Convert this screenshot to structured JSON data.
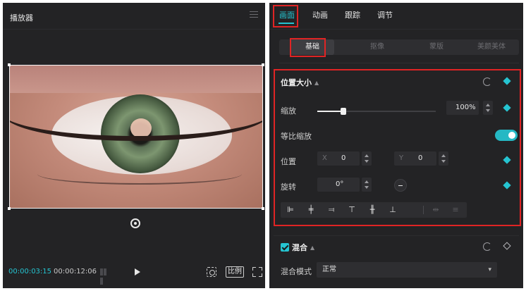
{
  "player": {
    "title": "播放器",
    "current_time": "00:00:03:15",
    "total_time": "00:00:12:06",
    "ratio_label": "比例"
  },
  "inspector": {
    "tabs": [
      {
        "label": "画面",
        "active": true
      },
      {
        "label": "动画",
        "active": false
      },
      {
        "label": "跟踪",
        "active": false
      },
      {
        "label": "调节",
        "active": false
      }
    ],
    "subtabs": [
      {
        "label": "基础",
        "active": true
      },
      {
        "label": "抠像",
        "active": false
      },
      {
        "label": "蒙版",
        "active": false
      },
      {
        "label": "美颜美体",
        "active": false
      }
    ],
    "position_size": {
      "title": "位置大小",
      "scale_label": "缩放",
      "scale_value": "100%",
      "scale_slider_level": 0.22,
      "uniform_scale_label": "等比缩放",
      "uniform_scale_on": true,
      "position_label": "位置",
      "x_prefix": "X",
      "x_value": "0",
      "y_prefix": "Y",
      "y_value": "0",
      "rotation_label": "旋转",
      "rotation_value": "0°"
    },
    "blend": {
      "title": "混合",
      "enabled": true,
      "mode_label": "混合模式",
      "mode_value": "正常"
    }
  },
  "colors": {
    "accent": "#25c4d1",
    "highlight": "#e02424",
    "panel": "#232325"
  },
  "icons": [
    "menu-icon",
    "recenter-icon",
    "grid-icon",
    "play-icon",
    "snapshot-icon",
    "fullscreen-icon",
    "reset-icon",
    "keyframe-diamond-icon",
    "align-left-icon",
    "align-center-h-icon",
    "align-right-icon",
    "align-top-icon",
    "align-center-v-icon",
    "align-bottom-icon",
    "distribute-h-icon",
    "distribute-v-icon",
    "chevron-down-icon"
  ]
}
